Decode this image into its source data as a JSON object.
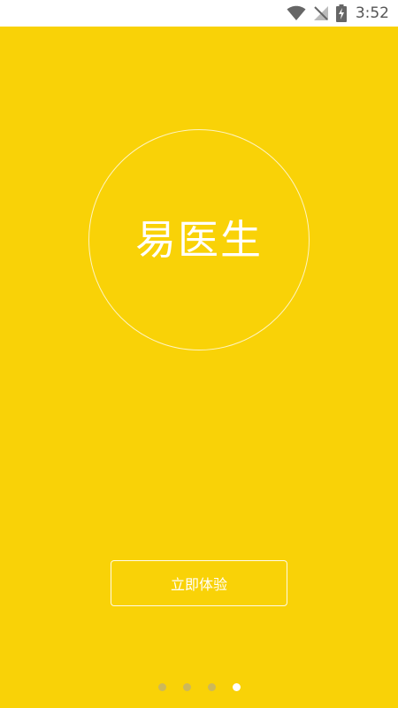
{
  "status_bar": {
    "time": "3:52",
    "icons": [
      "wifi-icon",
      "no-signal-icon",
      "battery-charging-icon"
    ]
  },
  "splash": {
    "app_title": "易医生",
    "start_button_label": "立即体验",
    "page_count": 4,
    "active_page": 4
  },
  "colors": {
    "background": "#F9D207",
    "foreground": "#FFFFFF",
    "inactive_dot": "#CDB85A"
  }
}
